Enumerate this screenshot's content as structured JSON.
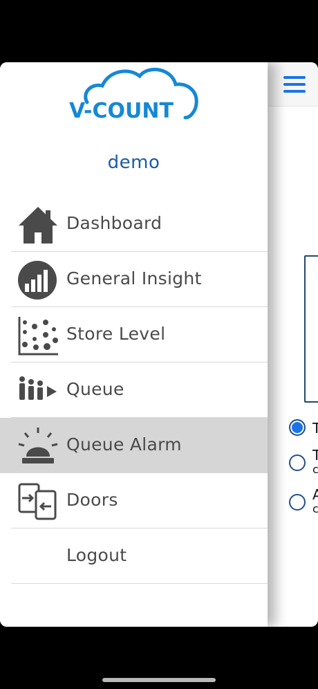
{
  "app": {
    "brand_name": "V-COUNT",
    "user_name": "demo"
  },
  "menu": {
    "items": [
      {
        "label": "Dashboard",
        "icon": "home-icon"
      },
      {
        "label": "General Insight",
        "icon": "bar-chart-circle-icon"
      },
      {
        "label": "Store Level",
        "icon": "scatter-plot-icon"
      },
      {
        "label": "Queue",
        "icon": "queue-people-icon"
      },
      {
        "label": "Queue Alarm",
        "icon": "alarm-siren-icon",
        "active": true
      },
      {
        "label": "Doors",
        "icon": "doors-icon"
      },
      {
        "label": "Logout"
      }
    ]
  },
  "background": {
    "radio_options": [
      {
        "text": "T",
        "sub": "",
        "checked": true
      },
      {
        "text": "T",
        "sub": "c",
        "checked": false
      },
      {
        "text": "A",
        "sub": "c",
        "checked": false
      }
    ]
  },
  "colors": {
    "accent": "#1a73e8",
    "brand": "#1a5aa8",
    "active_bg": "#d6d6d6",
    "icon": "#4a4a4a"
  }
}
